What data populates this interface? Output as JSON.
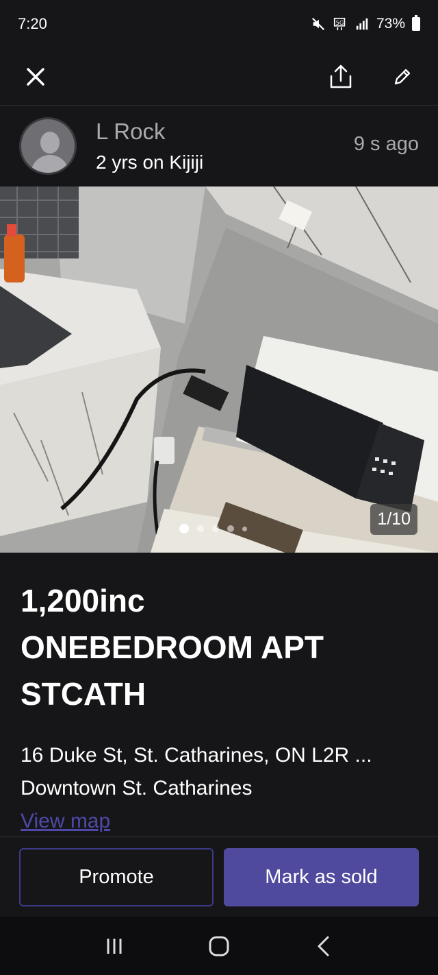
{
  "status_bar": {
    "time": "7:20",
    "battery": "73%",
    "icons": [
      "mute-icon",
      "5g-icon",
      "signal-icon",
      "battery-icon"
    ]
  },
  "top_bar": {
    "icons": [
      "close-icon",
      "share-icon",
      "edit-icon"
    ]
  },
  "seller": {
    "name": "L Rock",
    "tenure": "2 yrs on Kijiji",
    "posted": "9 s  ago"
  },
  "gallery": {
    "counter": "1/10",
    "total_dots": 5,
    "active_dot": 1
  },
  "listing": {
    "price": "1,200inc",
    "title": "ONEBEDROOM APT STCATH",
    "address": "16 Duke St, St. Catharines, ON L2R ...",
    "area": "Downtown St. Catharines",
    "view_map": "View map"
  },
  "actions": {
    "promote": "Promote",
    "mark_sold": "Mark as sold"
  },
  "colors": {
    "background": "#161618",
    "accent": "#4f4a9e",
    "link": "#4e49a8",
    "muted_text": "#a9a9ae"
  }
}
